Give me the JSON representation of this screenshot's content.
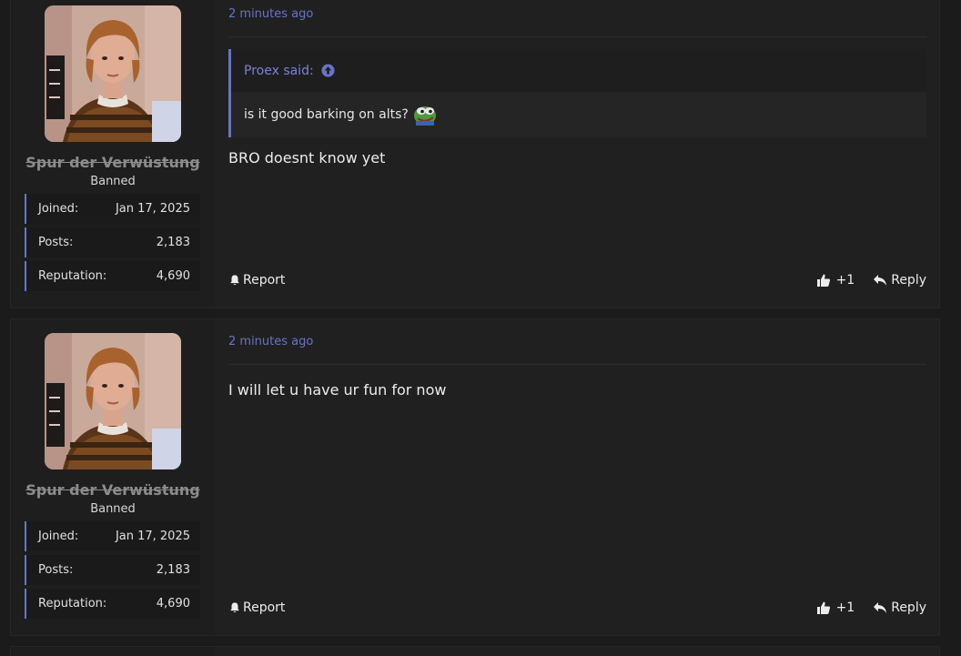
{
  "posts": [
    {
      "user": {
        "name": "Spur der Verwüstung",
        "title": "Banned",
        "stats": [
          {
            "label": "Joined:",
            "value": "Jan 17, 2025"
          },
          {
            "label": "Posts:",
            "value": "2,183"
          },
          {
            "label": "Reputation:",
            "value": "4,690"
          }
        ]
      },
      "timestamp": "2 minutes ago",
      "quote": {
        "author": "Proex said:",
        "text": "is it good barking on alts?"
      },
      "message": "BRO doesnt know yet",
      "actions": {
        "report": "Report",
        "likes": "+1",
        "reply": "Reply"
      }
    },
    {
      "user": {
        "name": "Spur der Verwüstung",
        "title": "Banned",
        "stats": [
          {
            "label": "Joined:",
            "value": "Jan 17, 2025"
          },
          {
            "label": "Posts:",
            "value": "2,183"
          },
          {
            "label": "Reputation:",
            "value": "4,690"
          }
        ]
      },
      "timestamp": "2 minutes ago",
      "message": "I will let u have ur fun for now",
      "actions": {
        "report": "Report",
        "likes": "+1",
        "reply": "Reply"
      }
    }
  ],
  "colors": {
    "accent": "#6a73c8",
    "background": "#1b1b1b",
    "panel": "#202020"
  }
}
